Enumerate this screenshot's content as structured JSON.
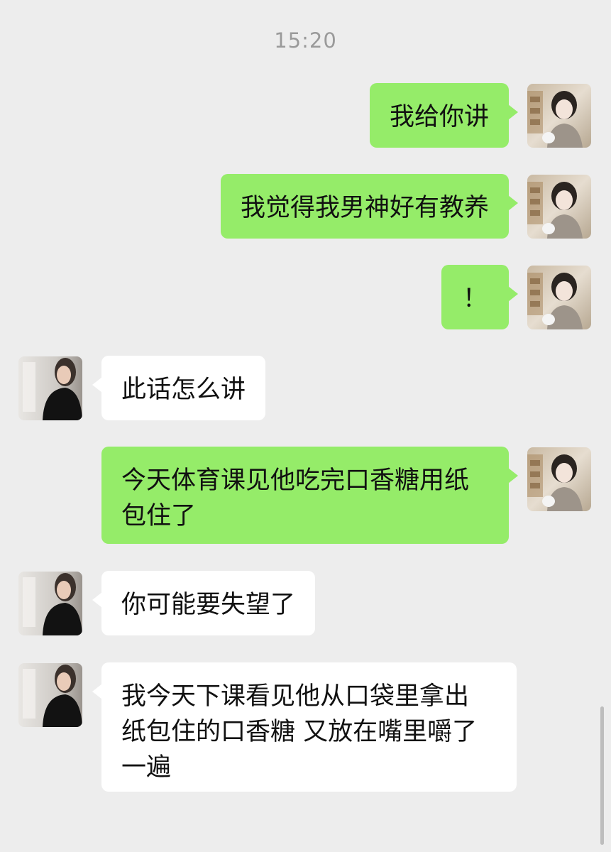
{
  "timestamp": "15:20",
  "messages": [
    {
      "from": "me",
      "text": "我给你讲"
    },
    {
      "from": "me",
      "text": "我觉得我男神好有教养"
    },
    {
      "from": "me",
      "text": "！"
    },
    {
      "from": "them",
      "text": "此话怎么讲"
    },
    {
      "from": "me",
      "text": "今天体育课见他吃完口香糖用纸\n包住了"
    },
    {
      "from": "them",
      "text": "你可能要失望了"
    },
    {
      "from": "them",
      "text": "我今天下课看见他从口袋里拿出\n纸包住的口香糖 又放在嘴里嚼了\n一遍"
    }
  ],
  "colors": {
    "background": "#ededed",
    "outgoing_bubble": "#95ec69",
    "incoming_bubble": "#ffffff",
    "timestamp_text": "#9a9a9a"
  },
  "icons": {
    "my_avatar": "girl-photo-avatar",
    "their_avatar": "person-dark-jacket-avatar"
  }
}
